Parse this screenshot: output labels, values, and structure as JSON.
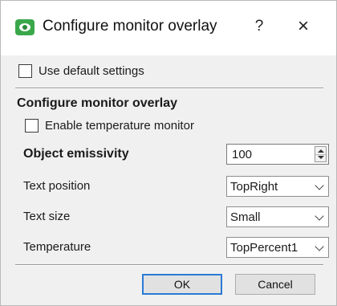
{
  "window": {
    "title": "Configure monitor overlay",
    "app_icon": "camera-eye-icon",
    "help_label": "?",
    "close_label": "×"
  },
  "use_default": {
    "label": "Use default settings",
    "checked": false
  },
  "section": {
    "title": "Configure monitor overlay"
  },
  "enable_temperature": {
    "label": "Enable temperature monitor",
    "checked": false
  },
  "emissivity": {
    "label": "Object emissivity",
    "value": "100"
  },
  "text_position": {
    "label": "Text position",
    "value": "TopRight"
  },
  "text_size": {
    "label": "Text size",
    "value": "Small"
  },
  "temperature": {
    "label": "Temperature",
    "value": "TopPercent1"
  },
  "buttons": {
    "ok": "OK",
    "cancel": "Cancel"
  }
}
